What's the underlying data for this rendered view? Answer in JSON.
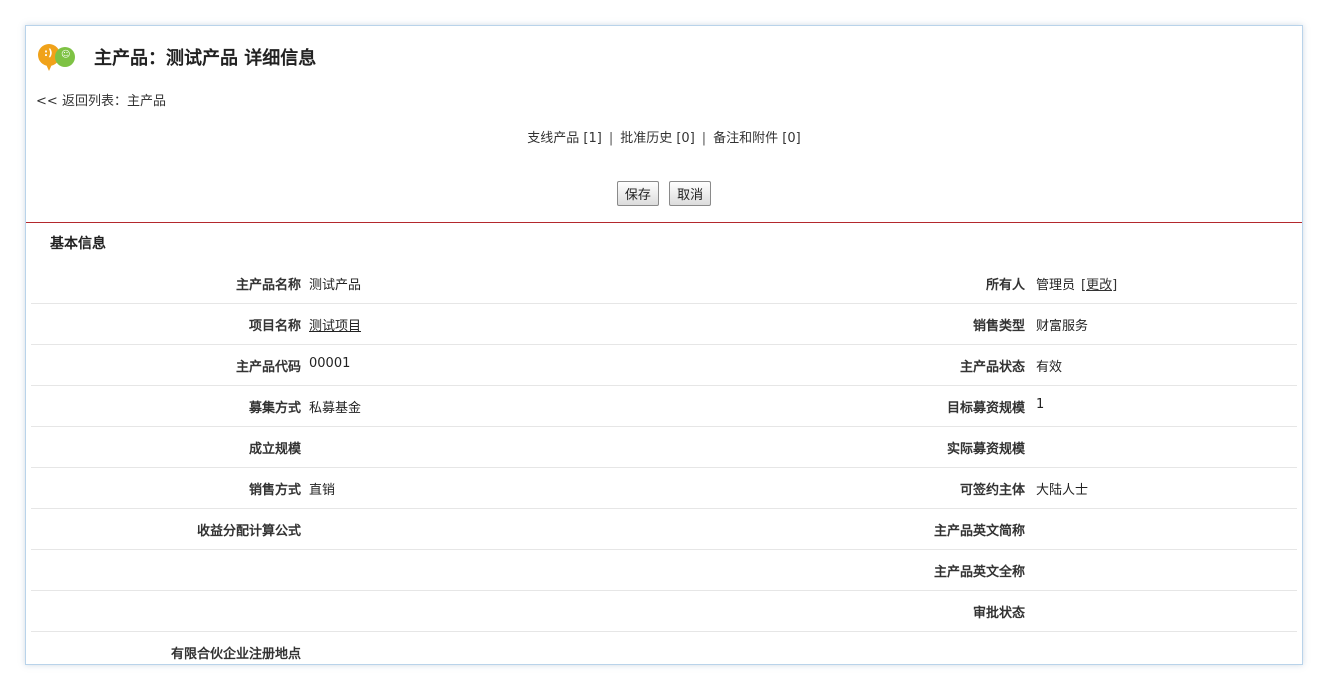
{
  "header": {
    "title": "主产品：测试产品 详细信息"
  },
  "back": {
    "prefix": "<<",
    "label": "返回列表：主产品"
  },
  "related": {
    "items": [
      "支线产品 [1]",
      "批准历史 [0]",
      "备注和附件 [0]"
    ],
    "separator": "|"
  },
  "buttons": {
    "save": "保存",
    "cancel": "取消"
  },
  "section": {
    "title": "基本信息"
  },
  "fields": {
    "r1": {
      "ll": "主产品名称",
      "lv": "测试产品",
      "rl": "所有人",
      "rv": "管理员",
      "change": "[更改]"
    },
    "r2": {
      "ll": "项目名称",
      "lv": "测试项目",
      "rl": "销售类型",
      "rv": "财富服务"
    },
    "r3": {
      "ll": "主产品代码",
      "lv": "00001",
      "rl": "主产品状态",
      "rv": "有效"
    },
    "r4": {
      "ll": "募集方式",
      "lv": "私募基金",
      "rl": "目标募资规模",
      "rv": "1"
    },
    "r5": {
      "ll": "成立规模",
      "lv": "",
      "rl": "实际募资规模",
      "rv": ""
    },
    "r6": {
      "ll": "销售方式",
      "lv": "直销",
      "rl": "可签约主体",
      "rv": "大陆人士"
    },
    "r7": {
      "ll": "收益分配计算公式",
      "lv": "",
      "rl": "主产品英文简称",
      "rv": ""
    },
    "r8": {
      "ll": "",
      "lv": "",
      "rl": "主产品英文全称",
      "rv": ""
    },
    "r9": {
      "ll": "",
      "lv": "",
      "rl": "审批状态",
      "rv": ""
    },
    "r10": {
      "ll": "有限合伙企业注册地点",
      "lv": "",
      "rl": "",
      "rv": ""
    }
  }
}
